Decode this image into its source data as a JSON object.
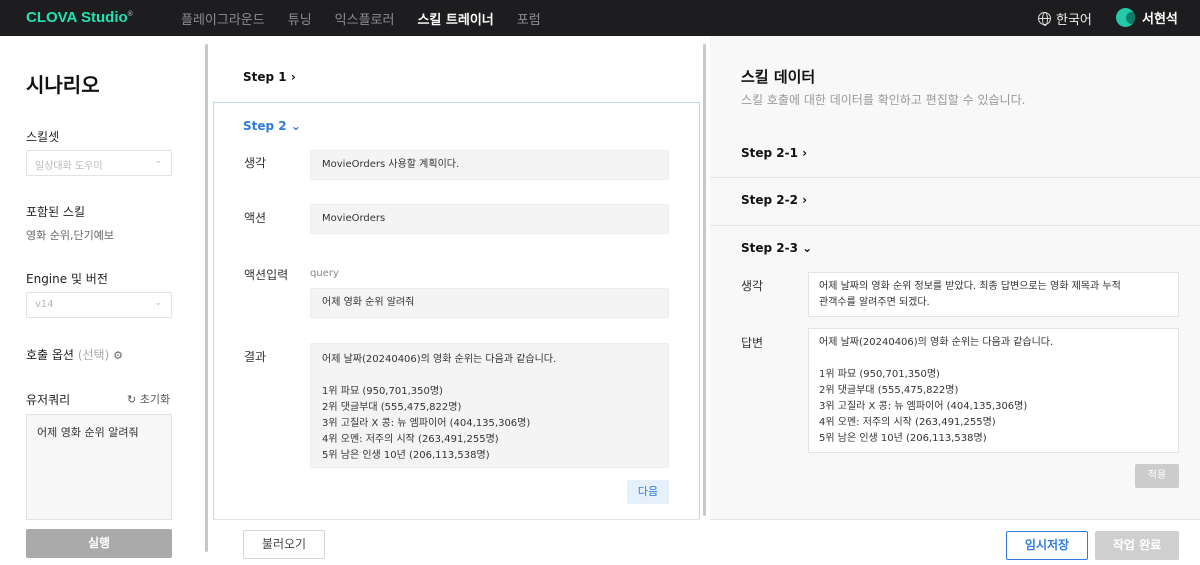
{
  "header": {
    "logo_text": "CLOVA Studio",
    "logo_mark": "®",
    "nav": [
      "플레이그라운드",
      "튜닝",
      "익스플로러",
      "스킬 트레이너",
      "포럼"
    ],
    "language": "한국어",
    "user_name": "서현석"
  },
  "sidebar": {
    "title": "시나리오",
    "skillset_label": "스킬셋",
    "skillset_value": "일상대화 도우미",
    "included_skills_label": "포함된 스킬",
    "included_skills_value": "영화 순위,단기예보",
    "engine_label": "Engine 및 버전",
    "engine_value": "v14",
    "call_options_label": "호출 옵션",
    "call_options_optional": "(선택)",
    "user_query_label": "유저쿼리",
    "reset_label": "초기화",
    "user_query_value": "어제 영화 순위 알려줘",
    "run_label": "실행"
  },
  "middle": {
    "step1_title": "Step 1",
    "step2_title": "Step 2",
    "thought_label": "생각",
    "thought_value": "MovieOrders 사용할 계획이다.",
    "action_label": "액션",
    "action_value": "MovieOrders",
    "action_input_label": "액션입력",
    "action_input_key": "query",
    "action_input_value": "어제 영화 순위 알려줘",
    "result_label": "결과",
    "result_value": "어제 날짜(20240406)의 영화 순위는 다음과 같습니다.\n\n1위 파묘 (950,701,350명)\n2위 댓글부대 (555,475,822명)\n3위 고질라 X 콩: 뉴 엠파이어 (404,135,306명)\n4위 오멘: 저주의 시작 (263,491,255명)\n5위 남은 인생 10년 (206,113,538명)",
    "next_label": "다음",
    "load_label": "불러오기"
  },
  "right": {
    "title": "스킬 데이터",
    "description": "스킬 호출에 대한 데이터를 확인하고 편집할 수 있습니다.",
    "step_2_1": "Step 2-1",
    "step_2_2": "Step 2-2",
    "step_2_3": "Step 2-3",
    "thought_label": "생각",
    "thought_value": "어제 날짜의 영화 순위 정보를 받았다. 최종 답변으로는 영화 제목과 누적\n관객수를 알려주면 되겠다.",
    "answer_label": "답변",
    "answer_value": "어제 날짜(20240406)의 영화 순위는 다음과 같습니다.\n\n1위 파묘 (950,701,350명)\n2위 댓글부대 (555,475,822명)\n3위 고질라 X 콩: 뉴 엠파이어 (404,135,306명)\n4위 오멘: 저주의 시작 (263,491,255명)\n5위 남은 인생 10년 (206,113,538명)",
    "apply_label": "적용",
    "save_draft_label": "임시저장",
    "complete_label": "작업 완료"
  },
  "icons": {
    "chevron_right": "›",
    "chevron_down": "⌄",
    "gear": "⚙",
    "refresh": "↻"
  }
}
